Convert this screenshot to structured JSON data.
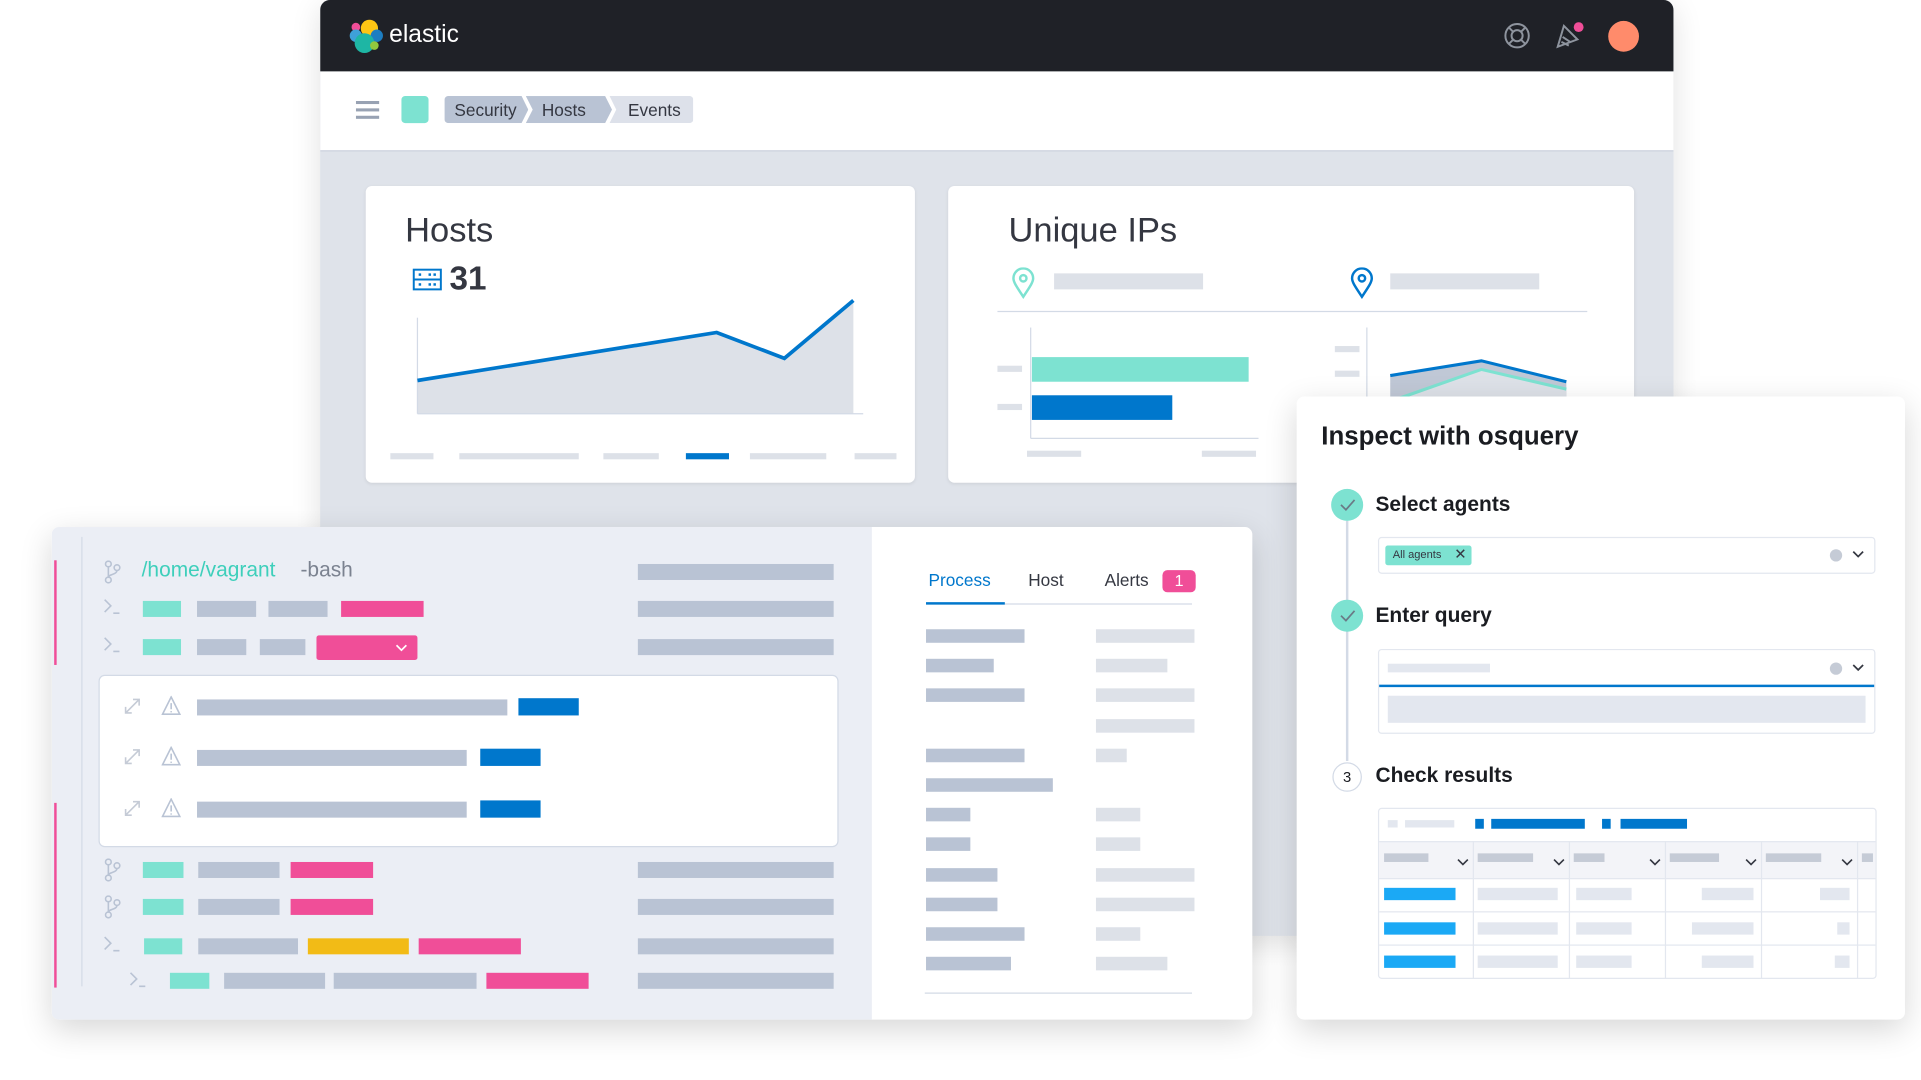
{
  "header": {
    "brand": "elastic",
    "icons": [
      "help-icon",
      "notifications-icon",
      "avatar"
    ],
    "colors": {
      "bar": "#1f2127",
      "avatar": "#ff8b6b",
      "notification_dot": "#f04e98"
    }
  },
  "breadcrumbs": [
    {
      "label": "Security"
    },
    {
      "label": "Hosts"
    },
    {
      "label": "Events"
    }
  ],
  "hosts_card": {
    "title": "Hosts",
    "count": "31",
    "icon": "server-icon"
  },
  "unique_ips_card": {
    "title": "Unique IPs",
    "icons": [
      "map-pin-teal-icon",
      "map-pin-blue-icon"
    ]
  },
  "terminal": {
    "path": "/home/vagrant",
    "command": "-bash"
  },
  "detail_tabs": [
    {
      "label": "Process",
      "active": true
    },
    {
      "label": "Host"
    },
    {
      "label": "Alerts",
      "badge": "1"
    }
  ],
  "osquery": {
    "title": "Inspect with osquery",
    "steps": [
      {
        "label": "Select agents",
        "status": "complete"
      },
      {
        "label": "Enter query",
        "status": "complete"
      },
      {
        "label": "Check results",
        "number": "3"
      }
    ],
    "agent_chip": "All agents"
  },
  "colors": {
    "accent": "#0077cc",
    "teal": "#7de2d1",
    "pink": "#f04e98",
    "yellow": "#f2bb16",
    "placeholder": "#b9c3d4"
  }
}
